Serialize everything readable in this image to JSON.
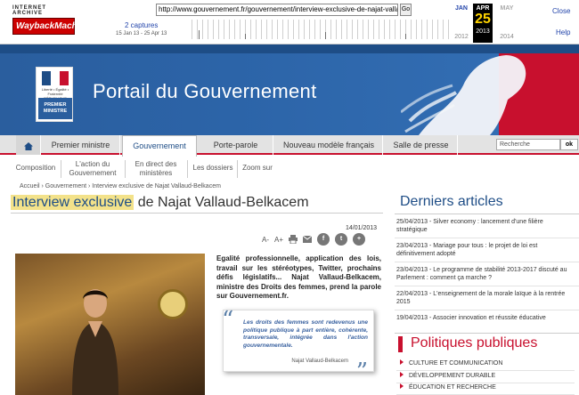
{
  "wayback": {
    "logo_top": "INTERNET ARCHIVE",
    "logo_main": "WaybackMachine",
    "url": "http://www.gouvernement.fr/gouvernement/interview-exclusive-de-najat-vallaud-b",
    "go": "Go",
    "captures": "2 captures",
    "range": "15 Jan 13 - 25 Apr 13",
    "prev_month": "JAN",
    "cur_month": "APR",
    "next_month": "MAY",
    "prev_year": "2012",
    "cur_day": "25",
    "cur_year": "2013",
    "next_year": "2014",
    "close": "Close",
    "help": "Help"
  },
  "banner": {
    "title": "Portail du Gouvernement",
    "logo_rf": "Liberté • Égalité • Fraternité RÉPUBLIQUE FRANÇAISE",
    "logo_pm": "PREMIER MINISTRE",
    "colors": {
      "blue": "#2a5e9e",
      "red": "#c8102e"
    }
  },
  "nav": {
    "items": [
      "Premier ministre",
      "Gouvernement",
      "Porte-parole",
      "Nouveau modèle français",
      "Salle de presse"
    ],
    "active": "Gouvernement",
    "search_placeholder": "Recherche",
    "search_button": "ok"
  },
  "subnav": {
    "items": [
      "Composition",
      "L'action du Gouvernement",
      "En direct des ministères",
      "Les dossiers",
      "Zoom sur"
    ]
  },
  "breadcrumb": "Accueil › Gouvernement › Interview exclusive de Najat Vallaud-Belkacem",
  "article": {
    "title_highlight": "Interview exclusive",
    "title_rest": " de Najat Vallaud-Belkacem",
    "date": "14/01/2013",
    "intro": "Egalité professionnelle, application des lois, travail sur les stéréotypes, Twitter, prochains défis législatifs... Najat Vallaud-Belkacem, ministre des Droits des femmes, prend la parole sur Gouvernement.fr.",
    "quote": "Les droits des femmes sont redevenus une politique publique à part entière, cohérente, transversale, intégrée dans l'action gouvernementale.",
    "quote_author": "Najat Vallaud-Belkacem",
    "tools": {
      "font_down": "A-",
      "font_up": "A+"
    }
  },
  "sidebar": {
    "title": "Derniers articles",
    "items": [
      "25/04/2013 - Silver economy : lancement d'une filière stratégique",
      "23/04/2013 - Mariage pour tous : le projet de loi est définitivement adopté",
      "23/04/2013 - Le programme de stabilité 2013-2017 discuté au Parlement : comment ça marche ?",
      "22/04/2013 - L'enseignement de la morale laïque à la rentrée 2015",
      "19/04/2013 - Associer innovation et réussite éducative"
    ],
    "politiques_title": "Politiques publiques",
    "politiques": [
      "CULTURE ET COMMUNICATION",
      "DÉVELOPPEMENT DURABLE",
      "ÉDUCATION ET RECHERCHE"
    ]
  }
}
